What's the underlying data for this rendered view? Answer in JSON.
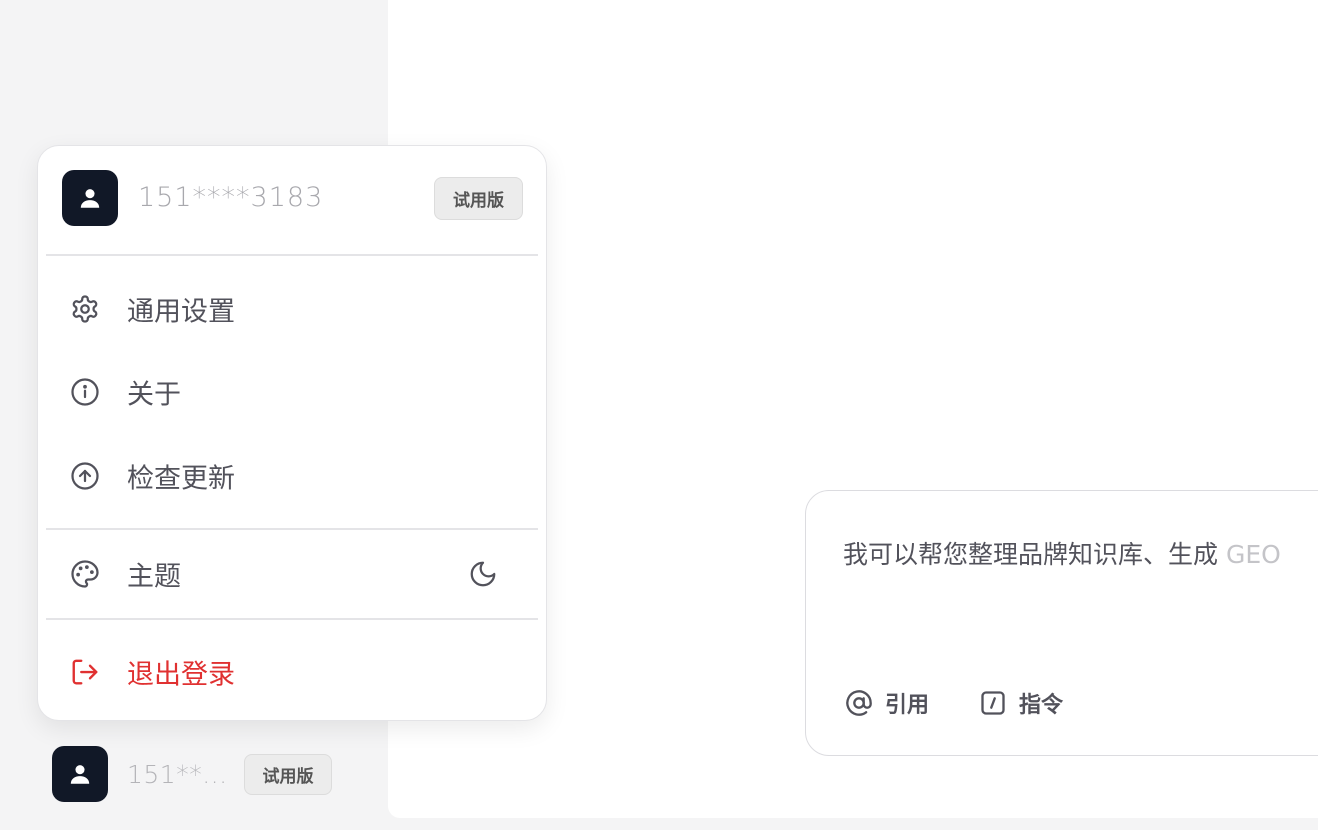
{
  "user": {
    "phone": "151****3183",
    "phone_truncated": "151**...",
    "plan_badge": "试用版"
  },
  "menu": {
    "items": [
      {
        "label": "通用设置",
        "icon": "gear-icon"
      },
      {
        "label": "关于",
        "icon": "info-icon"
      },
      {
        "label": "检查更新",
        "icon": "arrow-up-circle-icon"
      },
      {
        "label": "主题",
        "icon": "palette-icon",
        "right_icon": "moon-icon"
      },
      {
        "label": "退出登录",
        "icon": "logout-icon",
        "danger": true
      }
    ]
  },
  "composer": {
    "placeholder_main": "我可以帮您整理品牌知识库、生成 ",
    "placeholder_tail": "GEO",
    "tools": [
      {
        "label": "引用",
        "icon": "at-icon"
      },
      {
        "label": "指令",
        "icon": "slash-command-icon"
      }
    ]
  },
  "colors": {
    "danger": "#e03131",
    "avatar_bg": "#111827",
    "sidebar_bg": "#f4f4f5"
  }
}
